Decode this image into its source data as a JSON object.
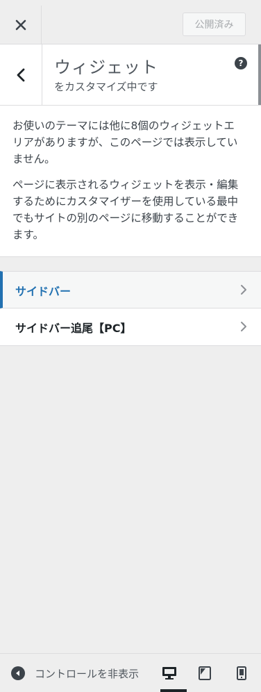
{
  "header": {
    "publish_label": "公開済み"
  },
  "section": {
    "title": "ウィジェット",
    "subtitle": "をカスタマイズ中です",
    "help_glyph": "?"
  },
  "description": {
    "paragraph1": "お使いのテーマには他に8個のウィジェットエリアがありますが、このページでは表示していません。",
    "paragraph2": "ページに表示されるウィジェットを表示・編集するためにカスタマイザーを使用している最中でもサイトの別のページに移動することができます。"
  },
  "widget_areas": [
    {
      "label": "サイドバー",
      "active": true
    },
    {
      "label": "サイドバー追尾【PC】",
      "active": false
    }
  ],
  "footer": {
    "collapse_label": "コントロールを非表示",
    "devices": [
      "desktop-icon",
      "tablet-icon",
      "mobile-icon"
    ],
    "selected_device": "desktop"
  },
  "colors": {
    "accent": "#2271b1",
    "text": "#3c434a",
    "panel_bg": "#eeeeee"
  }
}
